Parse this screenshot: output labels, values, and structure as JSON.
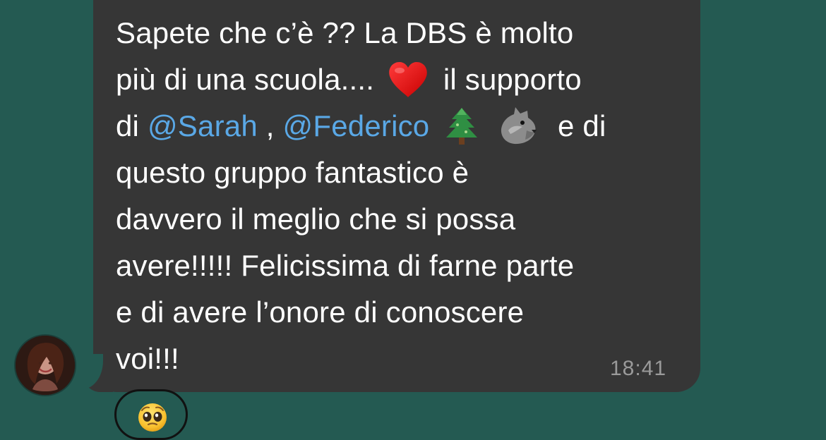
{
  "message": {
    "lines": [
      {
        "text": "Sapete che c’è ?? La DBS è molto"
      },
      {
        "before_emoji": "più di una scuola....",
        "emoji_name": "heart-emoji",
        "after_emoji": "il supporto"
      },
      {
        "prefix": "di",
        "mention_1": "@Sarah",
        "separator": ",",
        "mention_2": "@Federico",
        "emoji_1": "tree-emoji",
        "emoji_2": "wolf-emoji",
        "suffix": "e di"
      },
      {
        "text": "questo gruppo fantastico è"
      },
      {
        "text": "davvero il meglio che si possa"
      },
      {
        "text": "avere!!!!! Felicissima di farne parte"
      },
      {
        "text": "e di avere l’onore di conoscere"
      },
      {
        "text": "voi!!!"
      }
    ],
    "timestamp": "18:41"
  },
  "reaction": {
    "emoji_name": "pleading-face-emoji"
  },
  "avatar": {
    "name": "sender-avatar"
  },
  "colors": {
    "background": "#245a52",
    "bubble": "#363636",
    "text": "#ffffff",
    "mention": "#5aa8e6",
    "timestamp": "#9a9a9a"
  }
}
